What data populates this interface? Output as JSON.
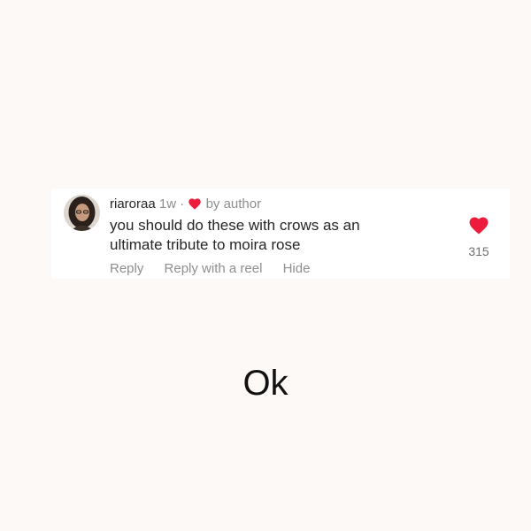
{
  "comment": {
    "username": "riaroraa",
    "time": "1w",
    "separator": "·",
    "liked_by_author": "by author",
    "text": "you should do these with crows as an ultimate tribute to moira rose",
    "like_count": "315",
    "actions": {
      "reply": "Reply",
      "reply_reel": "Reply with a reel",
      "hide": "Hide"
    },
    "heart_color": "#ed1c3b"
  },
  "caption": "Ok",
  "colors": {
    "background": "#fcf9f6",
    "card": "#ffffff",
    "muted_text": "#8e8e8e"
  }
}
